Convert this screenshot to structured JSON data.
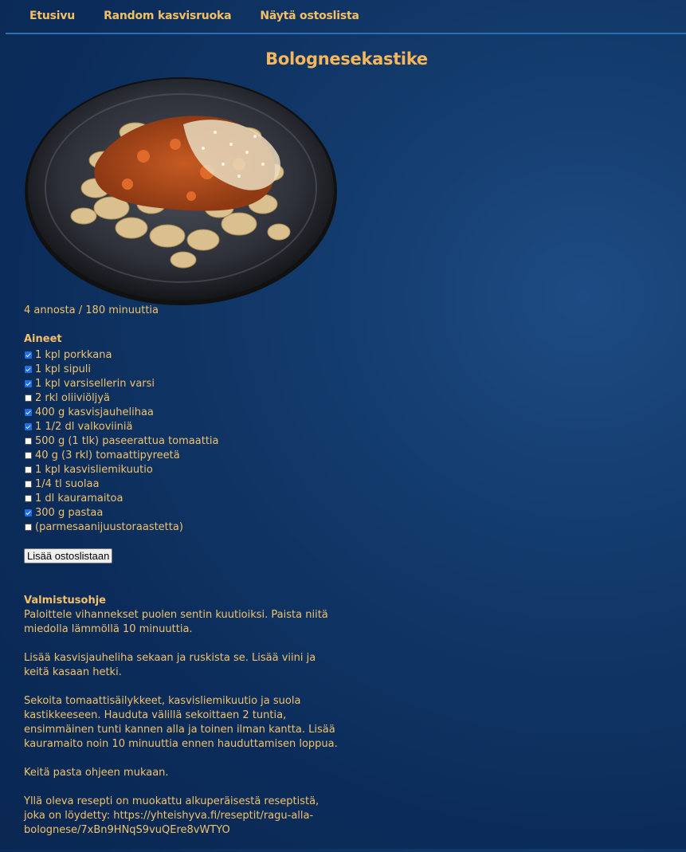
{
  "nav": {
    "home": "Etusivu",
    "random": "Random kasvisruoka",
    "shopping": "Näytä ostoslista"
  },
  "recipe": {
    "title": "Bolognesekastike",
    "meta": "4 annosta / 180 minuuttia",
    "ingredients_title": "Aineet",
    "ingredients": [
      {
        "label": "1 kpl porkkana",
        "checked": true
      },
      {
        "label": "1 kpl sipuli",
        "checked": true
      },
      {
        "label": "1 kpl varsisellerin varsi",
        "checked": true
      },
      {
        "label": "2 rkl oliiviöljyä",
        "checked": false
      },
      {
        "label": "400 g kasvisjauhelihaa",
        "checked": true
      },
      {
        "label": "1 1/2 dl valkoviiniä",
        "checked": true
      },
      {
        "label": "500 g (1 tlk) paseerattua tomaattia",
        "checked": false
      },
      {
        "label": "40 g (3 rkl) tomaattipyreetä",
        "checked": false
      },
      {
        "label": "1 kpl kasvisliemikuutio",
        "checked": false
      },
      {
        "label": "1/4 tl suolaa",
        "checked": false
      },
      {
        "label": "1 dl kauramaitoa",
        "checked": false
      },
      {
        "label": "300 g pastaa",
        "checked": true
      },
      {
        "label": "(parmesaanijuustoraastetta)",
        "checked": false
      }
    ],
    "add_button": "Lisää ostoslistaan",
    "instructions_title": "Valmistusohje",
    "instructions": [
      "Paloittele vihannekset puolen sentin kuutioiksi. Paista niitä miedolla lämmöllä 10 minuuttia.",
      "Lisää kasvisjauheliha sekaan ja ruskista se. Lisää viini ja keitä kasaan hetki.",
      "Sekoita tomaattisäilykkeet, kasvisliemikuutio ja suola kastikkeeseen. Hauduta välillä sekoittaen 2 tuntia, ensimmäinen tunti kannen alla ja toinen ilman kantta. Lisää kauramaito noin 10 minuuttia ennen hauduttamisen loppua.",
      "Keitä pasta ohjeen mukaan.",
      "Yllä oleva resepti on muokattu alkuperäisestä reseptistä, joka on löydetty: https://yhteishyva.fi/reseptit/ragu-alla-bolognese/7xBn9HNqS9vuQEre8vWTYO"
    ]
  },
  "colors": {
    "accent": "#f3c063",
    "background": "#0b2c5a",
    "divider": "#2a6fb2"
  }
}
